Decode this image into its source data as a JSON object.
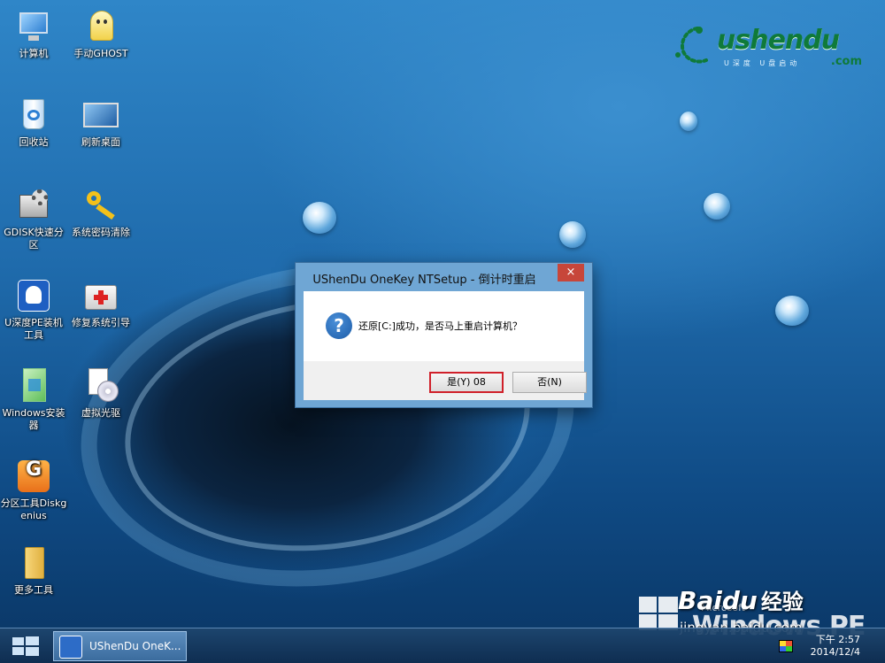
{
  "desktop_icons": [
    {
      "name": "computer-icon",
      "label": "计算机"
    },
    {
      "name": "ghost-icon",
      "label": "手动GHOST"
    },
    {
      "name": "recycle-bin-icon",
      "label": "回收站"
    },
    {
      "name": "refresh-desktop-icon",
      "label": "刷新桌面"
    },
    {
      "name": "gdisk-icon",
      "label": "GDISK快速分区"
    },
    {
      "name": "key-icon",
      "label": "系统密码清除"
    },
    {
      "name": "ushendu-pe-icon",
      "label": "U深度PE装机工具"
    },
    {
      "name": "repair-kit-icon",
      "label": "修复系统引导"
    },
    {
      "name": "windows-installer-icon",
      "label": "Windows安装器"
    },
    {
      "name": "virtual-drive-icon",
      "label": "虚拟光驱"
    },
    {
      "name": "diskgenius-icon",
      "label": "分区工具Diskgenius"
    },
    {
      "name": "folder-icon",
      "label": "更多工具"
    }
  ],
  "logo": {
    "brand": "ushendu",
    "dotcom": ".com",
    "tagline": "U深度 U盘启动"
  },
  "dialog": {
    "title": "UShenDu OneKey NTSetup - 倒计时重启",
    "close_label": "×",
    "icon": "question-icon",
    "message": "还原[C:]成功，是否马上重启计算机？",
    "yes_label": "是(Y) 08",
    "no_label": "否(N)"
  },
  "taskbar": {
    "task_label": "UShenDu OneK...",
    "time": "下午 2:57",
    "date": "2014/12/4"
  },
  "watermark": {
    "microsoft": "Microsoft",
    "windows_pe": "Windows PE",
    "baidu": "Baidu",
    "jingyan": "经验",
    "url": "jingyan.baidu.com"
  }
}
